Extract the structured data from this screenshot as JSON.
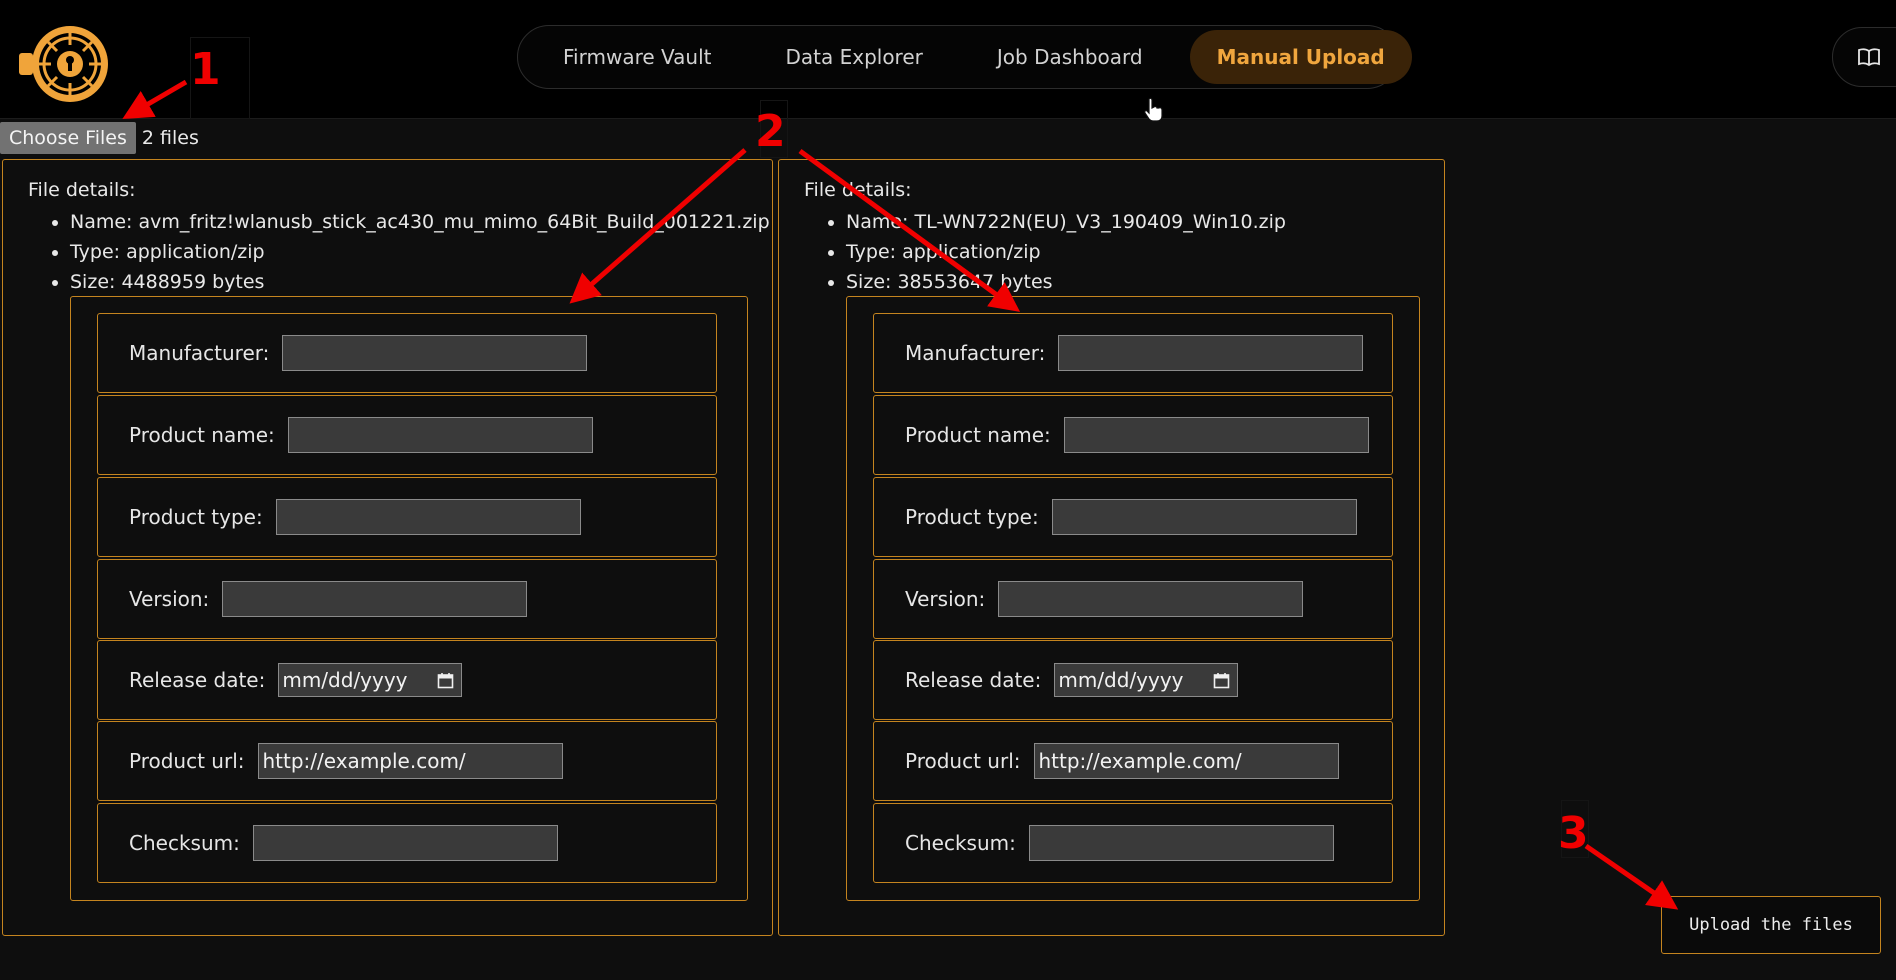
{
  "nav": {
    "items": [
      {
        "label": "Firmware Vault"
      },
      {
        "label": "Data Explorer"
      },
      {
        "label": "Job Dashboard"
      },
      {
        "label": "Manual Upload",
        "active": true
      }
    ]
  },
  "file_picker": {
    "button_label": "Choose Files",
    "status": "2 files"
  },
  "files": [
    {
      "details_title": "File details:",
      "name": "Name: avm_fritz!wlanusb_stick_ac430_mu_mimo_64Bit_Build_001221.zip",
      "type": "Type: application/zip",
      "size": "Size: 4488959 bytes",
      "fields": {
        "manufacturer_label": "Manufacturer:",
        "manufacturer_value": "",
        "product_name_label": "Product name:",
        "product_name_value": "",
        "product_type_label": "Product type:",
        "product_type_value": "",
        "version_label": "Version:",
        "version_value": "",
        "release_date_label": "Release date:",
        "release_date_value": "mm/dd/yyyy",
        "product_url_label": "Product url:",
        "product_url_value": "http://example.com/",
        "checksum_label": "Checksum:",
        "checksum_value": ""
      }
    },
    {
      "details_title": "File details:",
      "name": "Name: TL-WN722N(EU)_V3_190409_Win10.zip",
      "type": "Type: application/zip",
      "size": "Size: 38553647 bytes",
      "fields": {
        "manufacturer_label": "Manufacturer:",
        "manufacturer_value": "",
        "product_name_label": "Product name:",
        "product_name_value": "",
        "product_type_label": "Product type:",
        "product_type_value": "",
        "version_label": "Version:",
        "version_value": "",
        "release_date_label": "Release date:",
        "release_date_value": "mm/dd/yyyy",
        "product_url_label": "Product url:",
        "product_url_value": "http://example.com/",
        "checksum_label": "Checksum:",
        "checksum_value": ""
      }
    }
  ],
  "upload_button": "Upload the files",
  "annotations": [
    "1",
    "2",
    "3"
  ],
  "colors": {
    "accent": "#c4841f",
    "active_tab_text": "#f0a63e",
    "annotation": "#f00000"
  }
}
